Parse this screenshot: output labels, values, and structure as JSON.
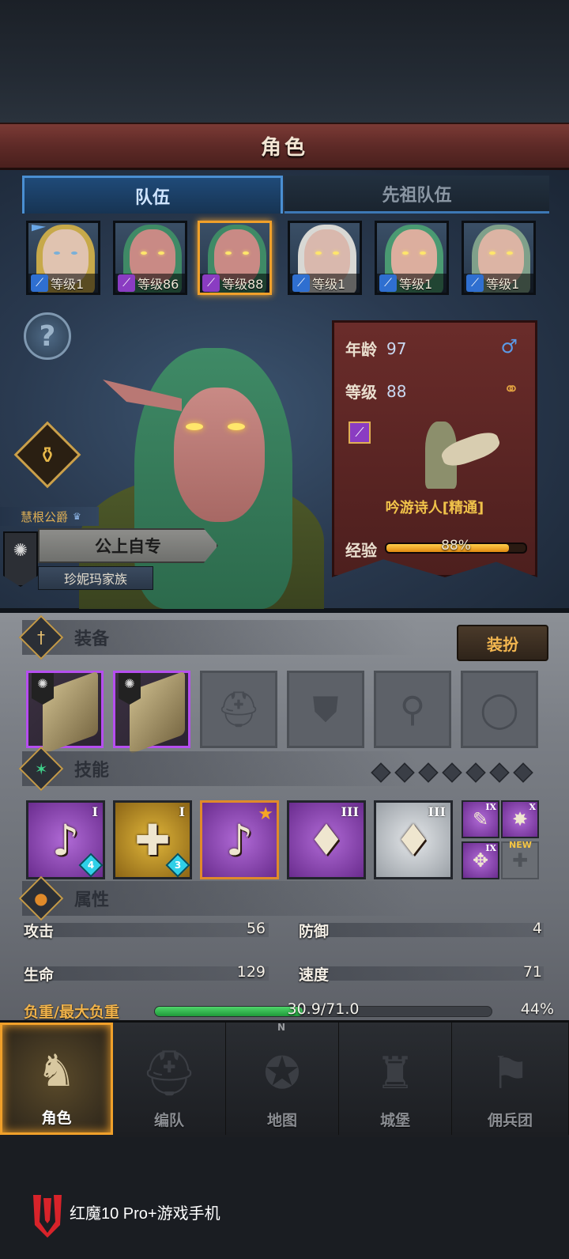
{
  "title": "角色",
  "tabs": [
    {
      "label": "队伍",
      "active": true
    },
    {
      "label": "先祖队伍",
      "active": false
    }
  ],
  "heroes": [
    {
      "level_text": "等级1",
      "class_icon": "sword-icon",
      "class_color": "blue",
      "hair": "blonde",
      "leader_flag": true
    },
    {
      "level_text": "等级86",
      "class_icon": "lute-staff-icon",
      "class_color": "purple",
      "hair": "green"
    },
    {
      "level_text": "等级88",
      "class_icon": "lute-staff-icon",
      "class_color": "purple",
      "hair": "green",
      "selected": true
    },
    {
      "level_text": "等级1",
      "class_icon": "sword-icon",
      "class_color": "blue",
      "hair": "white"
    },
    {
      "level_text": "等级1",
      "class_icon": "sword-icon",
      "class_color": "blue",
      "hair": "green"
    },
    {
      "level_text": "等级1",
      "class_icon": "sword-icon",
      "class_color": "blue",
      "hair": "green"
    }
  ],
  "character": {
    "noble_title": "慧根公爵",
    "name": "公上自专",
    "family": "珍妮玛家族",
    "age_label": "年龄",
    "age": "97",
    "level_label": "等级",
    "level": "88",
    "gender_icon": "male-icon",
    "class_name": "吟游诗人[精通]",
    "exp_label": "经验",
    "exp_text": "88%",
    "exp_fraction": 0.88
  },
  "equipment": {
    "title": "装备",
    "dress_button": "装扮",
    "slots": [
      "scroll",
      "scroll",
      "helmet",
      "armor",
      "boots",
      "ring"
    ]
  },
  "skills": {
    "title": "技能",
    "slots": [
      {
        "rank": "I",
        "badge": "4",
        "color": "purple",
        "glyph": "♪"
      },
      {
        "rank": "I",
        "badge": "3",
        "color": "gold",
        "glyph": "✚"
      },
      {
        "rank": "",
        "badge": "",
        "color": "purple",
        "glyph": "♪",
        "star": true,
        "selected": true
      },
      {
        "rank": "III",
        "badge": "",
        "color": "purple",
        "glyph": "♦"
      },
      {
        "rank": "III",
        "badge": "",
        "color": "silver",
        "glyph": "♦"
      }
    ],
    "mini": [
      {
        "rank": "IX",
        "glyph": "✎"
      },
      {
        "rank": "X",
        "glyph": "✸"
      },
      {
        "rank": "IX",
        "glyph": "✥"
      },
      {
        "rank": "",
        "glyph": "✚",
        "empty": true
      }
    ],
    "new_tag": "NEW"
  },
  "attributes": {
    "title": "属性",
    "attack_label": "攻击",
    "attack": "56",
    "defense_label": "防御",
    "defense": "4",
    "hp_label": "生命",
    "hp": "129",
    "speed_label": "速度",
    "speed": "71",
    "load_label": "负重/最大负重",
    "load_text": "30.9/71.0",
    "load_pct": "44%",
    "load_fraction": 0.44
  },
  "nav": [
    {
      "label": "角色",
      "icon": "knight-icon",
      "active": true
    },
    {
      "label": "编队",
      "icon": "helmet-icon"
    },
    {
      "label": "地图",
      "icon": "compass-map-icon"
    },
    {
      "label": "城堡",
      "icon": "castle-icon"
    },
    {
      "label": "佣兵团",
      "icon": "mercenary-flag-icon"
    }
  ],
  "compass_letter": "N",
  "brand": "红魔10 Pro+游戏手机"
}
